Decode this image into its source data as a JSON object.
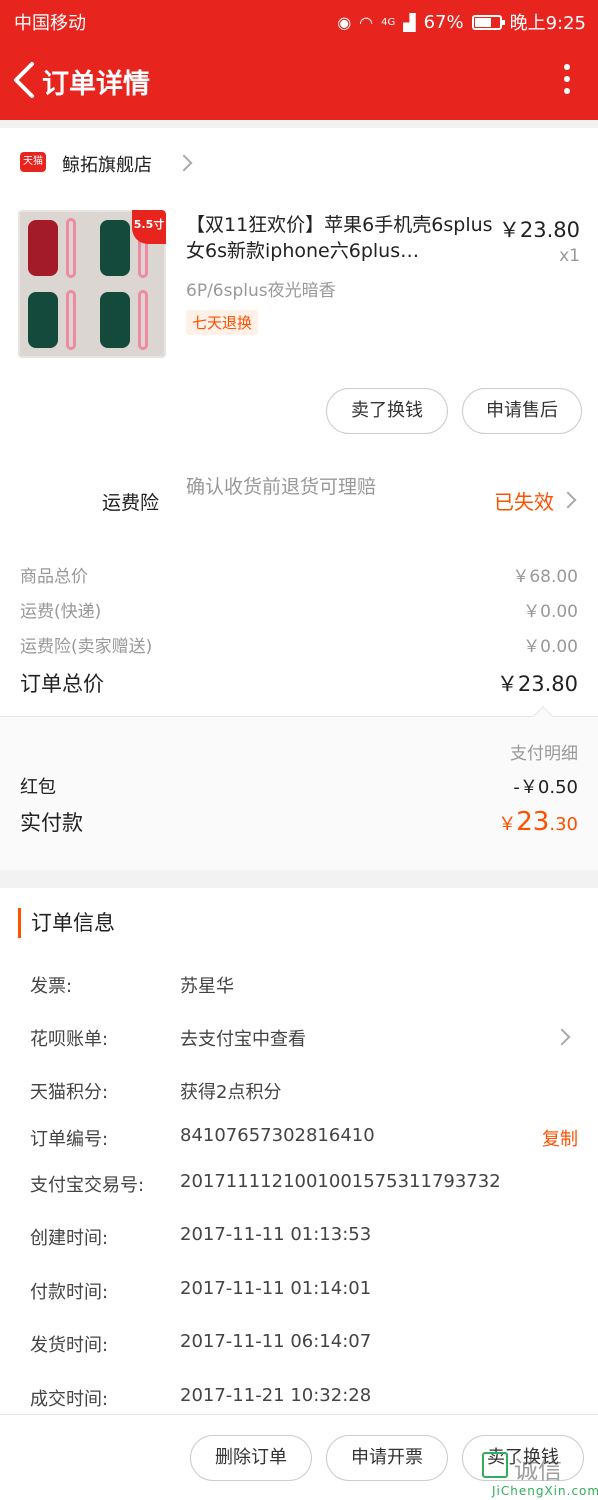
{
  "status_bar": {
    "carrier": "中国移动",
    "network": "4G",
    "battery": "67%",
    "time": "晚上9:25"
  },
  "nav": {
    "title": "订单详情"
  },
  "shop": {
    "name": "鲸拓旗舰店",
    "logo_text": "天猫"
  },
  "product": {
    "image_badge": "5.5寸",
    "title": "【双11狂欢价】苹果6手机壳6splus女6s新款iphone六6plus…",
    "price": "￥23.80",
    "quantity": "x1",
    "spec": "6P/6splus夜光暗香",
    "tag": "七天退换"
  },
  "product_actions": {
    "sell": "卖了换钱",
    "after_sale": "申请售后"
  },
  "insurance": {
    "label": "运费险",
    "description": "确认收货前退货可理赔",
    "status": "已失效"
  },
  "summary": {
    "rows": [
      {
        "label": "商品总价",
        "value": "￥68.00"
      },
      {
        "label": "运费(快递)",
        "value": "￥0.00"
      },
      {
        "label": "运费险(卖家赠送)",
        "value": "￥0.00"
      }
    ],
    "total_label": "订单总价",
    "total_value": "￥23.80"
  },
  "payment": {
    "detail_link": "支付明细",
    "redpacket_label": "红包",
    "redpacket_value": "-￥0.50",
    "paid_label": "实付款",
    "paid_currency": "￥",
    "paid_integer": "23",
    "paid_decimal": ".30"
  },
  "order_info": {
    "header": "订单信息",
    "rows": [
      {
        "label": "发票:",
        "value": "苏星华"
      },
      {
        "label": "花呗账单:",
        "value": "去支付宝中查看"
      },
      {
        "label": "天猫积分:",
        "value": "获得2点积分"
      },
      {
        "label": "订单编号:",
        "value": "84107657302816410",
        "action": "复制"
      },
      {
        "label": "支付宝交易号:",
        "value": "2017111121001001575311793732"
      },
      {
        "label": "创建时间:",
        "value": "2017-11-11 01:13:53"
      },
      {
        "label": "付款时间:",
        "value": "2017-11-11 01:14:01"
      },
      {
        "label": "发货时间:",
        "value": "2017-11-11 06:14:07"
      },
      {
        "label": "成交时间:",
        "value": "2017-11-21 10:32:28"
      }
    ]
  },
  "bottom_actions": {
    "delete": "删除订单",
    "invoice": "申请开票",
    "sell": "卖了换钱"
  },
  "watermark": {
    "text": "诚信",
    "url": "JiChengXin.com"
  },
  "colors": {
    "header_red": "#e8241f",
    "accent_orange": "#ff5000",
    "watermark_green": "#2fae5b"
  }
}
